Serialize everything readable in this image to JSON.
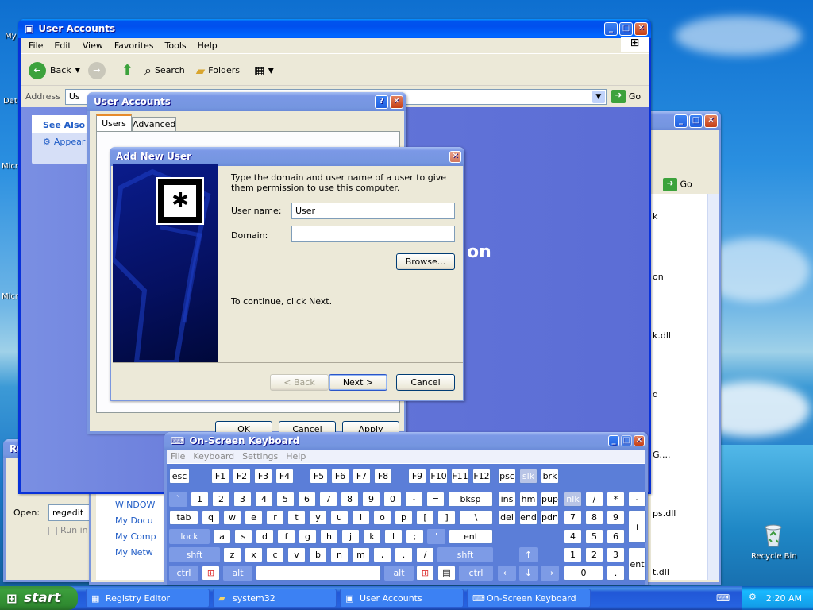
{
  "desktop": {
    "icons": [
      "My",
      "Dat",
      "Micr",
      "Micr",
      "Recycle Bin"
    ],
    "recycle_bin": "Recycle Bin"
  },
  "explorer": {
    "title": "User Accounts",
    "menu": [
      "File",
      "Edit",
      "View",
      "Favorites",
      "Tools",
      "Help"
    ],
    "toolbar": {
      "back": "Back",
      "search": "Search",
      "folders": "Folders"
    },
    "address_label": "Address",
    "address_value": "Us",
    "go": "Go",
    "see_also": "See Also",
    "appearance": "Appear",
    "banner_text": "on"
  },
  "explorer2": {
    "go": "Go",
    "items": [
      "k",
      "on",
      "k.dll",
      "d",
      "G....",
      "ps.dll",
      "t.dll"
    ],
    "links": [
      "WINDOW",
      "My Docu",
      "My Comp",
      "My Netw"
    ]
  },
  "run": {
    "title": "Ru",
    "open_label": "Open:",
    "open_value": "regedit",
    "run_in": "Run in s"
  },
  "user_accounts": {
    "title": "User Accounts",
    "tabs": [
      "Users",
      "Advanced"
    ],
    "ok": "OK",
    "cancel": "Cancel",
    "apply": "Apply"
  },
  "add_user": {
    "title": "Add New User",
    "instructions": "Type the domain and user name of a user to give them permission to use this computer.",
    "username_label": "User name:",
    "username_value": "User",
    "domain_label": "Domain:",
    "domain_value": "",
    "browse": "Browse...",
    "continue": "To continue, click Next.",
    "back": "< Back",
    "next": "Next >",
    "cancel": "Cancel"
  },
  "osk": {
    "title": "On-Screen Keyboard",
    "menu": [
      "File",
      "Keyboard",
      "Settings",
      "Help"
    ],
    "row1": [
      "esc",
      "F1",
      "F2",
      "F3",
      "F4",
      "F5",
      "F6",
      "F7",
      "F8",
      "F9",
      "F10",
      "F11",
      "F12",
      "psc",
      "slk",
      "brk"
    ],
    "row2": [
      "`",
      "1",
      "2",
      "3",
      "4",
      "5",
      "6",
      "7",
      "8",
      "9",
      "0",
      "-",
      "=",
      "bksp",
      "ins",
      "hm",
      "pup",
      "nlk",
      "/",
      "*",
      "-"
    ],
    "row3": [
      "tab",
      "q",
      "w",
      "e",
      "r",
      "t",
      "y",
      "u",
      "i",
      "o",
      "p",
      "[",
      "]",
      "\\",
      "del",
      "end",
      "pdn",
      "7",
      "8",
      "9",
      "+"
    ],
    "row4": [
      "lock",
      "a",
      "s",
      "d",
      "f",
      "g",
      "h",
      "j",
      "k",
      "l",
      ";",
      "'",
      "ent",
      "4",
      "5",
      "6"
    ],
    "row5": [
      "shft",
      "z",
      "x",
      "c",
      "v",
      "b",
      "n",
      "m",
      ",",
      ".",
      "/",
      "shft",
      "↑",
      "1",
      "2",
      "3",
      "ent"
    ],
    "row6": [
      "ctrl",
      "alt",
      "alt",
      "ctrl",
      "←",
      "↓",
      "→",
      "0",
      "."
    ]
  },
  "taskbar": {
    "start": "start",
    "tasks": [
      "Registry Editor",
      "system32",
      "User Accounts",
      "On-Screen Keyboard"
    ],
    "clock": "2:20 AM"
  }
}
